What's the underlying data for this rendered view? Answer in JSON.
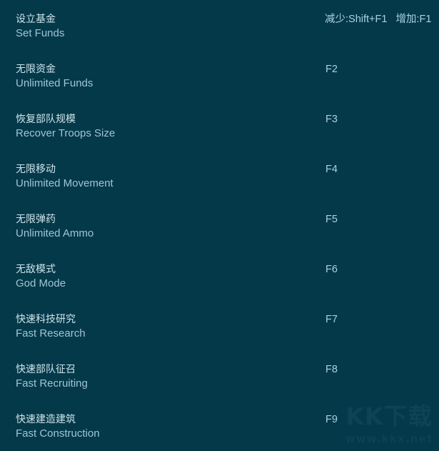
{
  "panel": {
    "background_color": "#04394a",
    "cn_text_color": "#cfe4ea",
    "en_text_color": "#9fc6d4",
    "hotkey_color": "#a9d2e0"
  },
  "watermark": {
    "mark": "KK下载",
    "url": "www.kkx.net",
    "color": "#0e4254"
  },
  "cheats": [
    {
      "name_cn": "设立基金",
      "name_en": "Set Funds",
      "hotkey_decrease_label": "减少:Shift+F1",
      "hotkey_increase_label": "增加:F1",
      "hotkey": "减少:Shift+F1   增加:F1"
    },
    {
      "name_cn": "无限资金",
      "name_en": "Unlimited Funds",
      "hotkey": "F2"
    },
    {
      "name_cn": "恢复部队规模",
      "name_en": "Recover Troops Size",
      "hotkey": "F3"
    },
    {
      "name_cn": "无限移动",
      "name_en": "Unlimited Movement",
      "hotkey": "F4"
    },
    {
      "name_cn": "无限弹药",
      "name_en": "Unlimited Ammo",
      "hotkey": "F5"
    },
    {
      "name_cn": "无敌模式",
      "name_en": "God Mode",
      "hotkey": "F6"
    },
    {
      "name_cn": "快速科技研究",
      "name_en": "Fast Research",
      "hotkey": "F7"
    },
    {
      "name_cn": "快速部队征召",
      "name_en": "Fast Recruiting",
      "hotkey": "F8"
    },
    {
      "name_cn": "快速建造建筑",
      "name_en": "Fast Construction",
      "hotkey": "F9"
    }
  ]
}
